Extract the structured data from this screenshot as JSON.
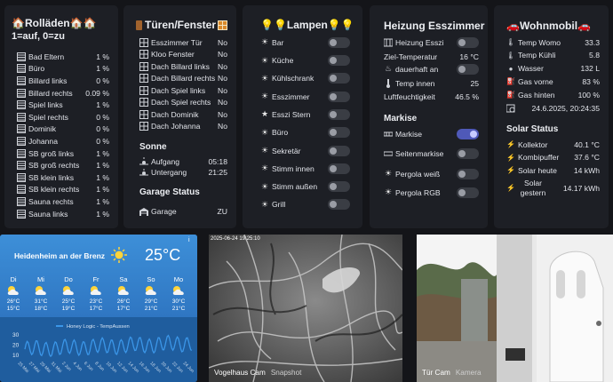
{
  "rollladen": {
    "title": "🏠Rolläden🏠🏠",
    "subtitle": "1=auf, 0=zu",
    "items": [
      {
        "label": "Bad Eltern",
        "value": "1 %"
      },
      {
        "label": "Büro",
        "value": "1 %"
      },
      {
        "label": "Billard links",
        "value": "0 %"
      },
      {
        "label": "Billard rechts",
        "value": "0.09 %"
      },
      {
        "label": "Spiel links",
        "value": "1 %"
      },
      {
        "label": "Spiel rechts",
        "value": "0 %"
      },
      {
        "label": "Dominik",
        "value": "0 %"
      },
      {
        "label": "Johanna",
        "value": "0 %"
      },
      {
        "label": "SB groß links",
        "value": "1 %"
      },
      {
        "label": "SB groß rechts",
        "value": "1 %"
      },
      {
        "label": "SB klein links",
        "value": "1 %"
      },
      {
        "label": "SB klein rechts",
        "value": "1 %"
      },
      {
        "label": "Sauna rechts",
        "value": "1 %"
      },
      {
        "label": "Sauna links",
        "value": "1 %"
      }
    ]
  },
  "tueren": {
    "title": "Türen/Fenster",
    "items": [
      {
        "label": "Esszimmer Tür",
        "value": "No"
      },
      {
        "label": "Kloo Fenster",
        "value": "No"
      },
      {
        "label": "Dach Billard links",
        "value": "No"
      },
      {
        "label": "Dach Billard rechts",
        "value": "No"
      },
      {
        "label": "Dach Spiel links",
        "value": "No"
      },
      {
        "label": "Dach Spiel rechts",
        "value": "No"
      },
      {
        "label": "Dach Dominik",
        "value": "No"
      },
      {
        "label": "Dach Johanna",
        "value": "No"
      }
    ],
    "sonne_title": "Sonne",
    "aufgang_label": "Aufgang",
    "aufgang": "05:18",
    "untergang_label": "Untergang",
    "untergang": "21:25",
    "garage_title": "Garage Status",
    "garage_label": "Garage",
    "garage": "ZU"
  },
  "lampen": {
    "title": "💡💡Lampen💡💡",
    "items": [
      {
        "label": "Bar",
        "on": false
      },
      {
        "label": "Küche",
        "on": false
      },
      {
        "label": "Kühlschrank",
        "on": false
      },
      {
        "label": "Esszimmer",
        "on": false
      },
      {
        "label": "Esszi Stern",
        "on": false
      },
      {
        "label": "Büro",
        "on": false
      },
      {
        "label": "Sekretär",
        "on": false
      },
      {
        "label": "Stimm innen",
        "on": false
      },
      {
        "label": "Stimm außen",
        "on": false
      },
      {
        "label": "Grill",
        "on": false
      }
    ]
  },
  "heizung": {
    "title": "Heizung Esszimmer",
    "esszi_label": "Heizung Esszi",
    "ziel_label": "Ziel-Temperatur",
    "ziel": "16 °C",
    "dauer_label": "dauerhaft an",
    "temp_label": "Temp innen",
    "temp": "25",
    "luft_label": "Luftfeuchtigkeit",
    "luft": "46.5 %",
    "markise_title": "Markise",
    "markise_label": "Markise",
    "markise_on": true,
    "seiten_label": "Seitenmarkise",
    "pergola_w_label": "Pergola weiß",
    "pergola_rgb_label": "Pergola RGB"
  },
  "wohnmobil": {
    "title": "🚗Wohnmobil🚗",
    "items": [
      {
        "label": "Temp Womo",
        "value": "33.3"
      },
      {
        "label": "Temp Kühli",
        "value": "5.8"
      },
      {
        "label": "Wasser",
        "value": "132 L"
      },
      {
        "label": "Gas vorne",
        "value": "83 %"
      },
      {
        "label": "Gas hinten",
        "value": "100 %"
      }
    ],
    "date": "24.6.2025, 20:24:35",
    "solar_title": "Solar Status",
    "solar": [
      {
        "label": "Kollektor",
        "value": "40.1 °C"
      },
      {
        "label": "Kombipuffer",
        "value": "37.6 °C"
      },
      {
        "label": "Solar heute",
        "value": "14 kWh"
      },
      {
        "label": "Solar gestern",
        "value": "14.17 kWh"
      }
    ]
  },
  "weather": {
    "location": "Heidenheim an der Brenz",
    "temp": "25°C",
    "info": "i",
    "days": [
      {
        "d": "Di",
        "hi": "26°C",
        "lo": "15°C"
      },
      {
        "d": "Mi",
        "hi": "31°C",
        "lo": "18°C"
      },
      {
        "d": "Do",
        "hi": "25°C",
        "lo": "19°C"
      },
      {
        "d": "Fr",
        "hi": "23°C",
        "lo": "17°C"
      },
      {
        "d": "Sa",
        "hi": "26°C",
        "lo": "17°C"
      },
      {
        "d": "So",
        "hi": "29°C",
        "lo": "21°C"
      },
      {
        "d": "Mo",
        "hi": "30°C",
        "lo": "21°C"
      }
    ],
    "chart_legend": "Honey Logic - TempAussen",
    "yticks": [
      "30",
      "20",
      "10"
    ],
    "xticks": [
      "25 Mai",
      "27 Mai",
      "29 Mai",
      "31 Mai",
      "2 Jun",
      "4 Jun",
      "6 Jun",
      "8 Jun",
      "10 Jun",
      "12 Jun",
      "14 Jun",
      "16 Jun",
      "18 Jun",
      "20 Jun",
      "22 Jun",
      "24 Jun"
    ]
  },
  "cam1": {
    "name": "Vogelhaus Cam",
    "kind": "Snapshot",
    "timestamp": "2025-06-24 19:25:10"
  },
  "cam2": {
    "name": "Tür Cam",
    "kind": "Kamera"
  },
  "colors": {
    "card": "#1d1f25",
    "bg": "#141519",
    "accent": "#4f59b8",
    "weather": "#3d8fd8",
    "chart": "#3b96e8"
  }
}
